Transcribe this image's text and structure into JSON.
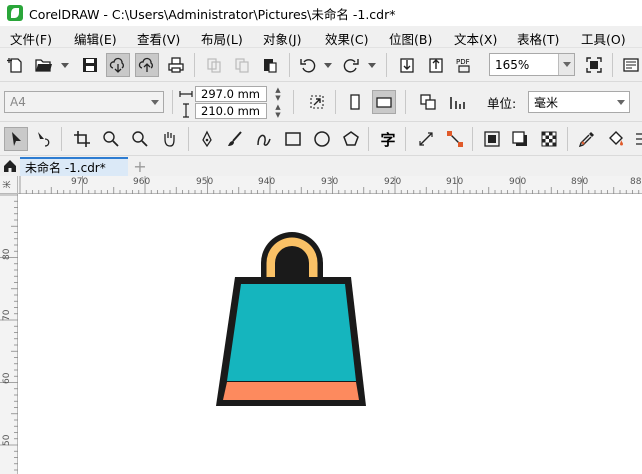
{
  "window": {
    "title": "CorelDRAW - C:\\Users\\Administrator\\Pictures\\未命名 -1.cdr*"
  },
  "menu": [
    {
      "key": "file",
      "label": "文件(F)",
      "underline": "F"
    },
    {
      "key": "edit",
      "label": "编辑(E)"
    },
    {
      "key": "view",
      "label": "查看(V)"
    },
    {
      "key": "layout",
      "label": "布局(L)"
    },
    {
      "key": "object",
      "label": "对象(J)"
    },
    {
      "key": "effects",
      "label": "效果(C)"
    },
    {
      "key": "bitmaps",
      "label": "位图(B)"
    },
    {
      "key": "text",
      "label": "文本(X)"
    },
    {
      "key": "table",
      "label": "表格(T)"
    },
    {
      "key": "tools",
      "label": "工具(O)"
    }
  ],
  "toolbar": {
    "zoom": "165%",
    "pdf_label": "PDF"
  },
  "property_bar": {
    "page_size": "A4",
    "width": "297.0 mm",
    "height": "210.0 mm",
    "units_label": "单位:",
    "units_value": "毫米"
  },
  "toolbox": {
    "text_tool_glyph": "字"
  },
  "tabs": {
    "document": "未命名 -1.cdr*",
    "add": "+"
  },
  "ruler": {
    "unit": "米",
    "h_labels": [
      "970",
      "960",
      "950",
      "940",
      "930",
      "920",
      "910",
      "900",
      "890",
      "88"
    ],
    "v_labels": [
      "80",
      "70",
      "60",
      "50"
    ]
  },
  "colors": {
    "bag_body": "#15b5be",
    "bag_band": "#fd8a5e",
    "bag_handle": "#fac166",
    "outline": "#1a1a1a",
    "tab_accent": "#2d7cd1"
  }
}
